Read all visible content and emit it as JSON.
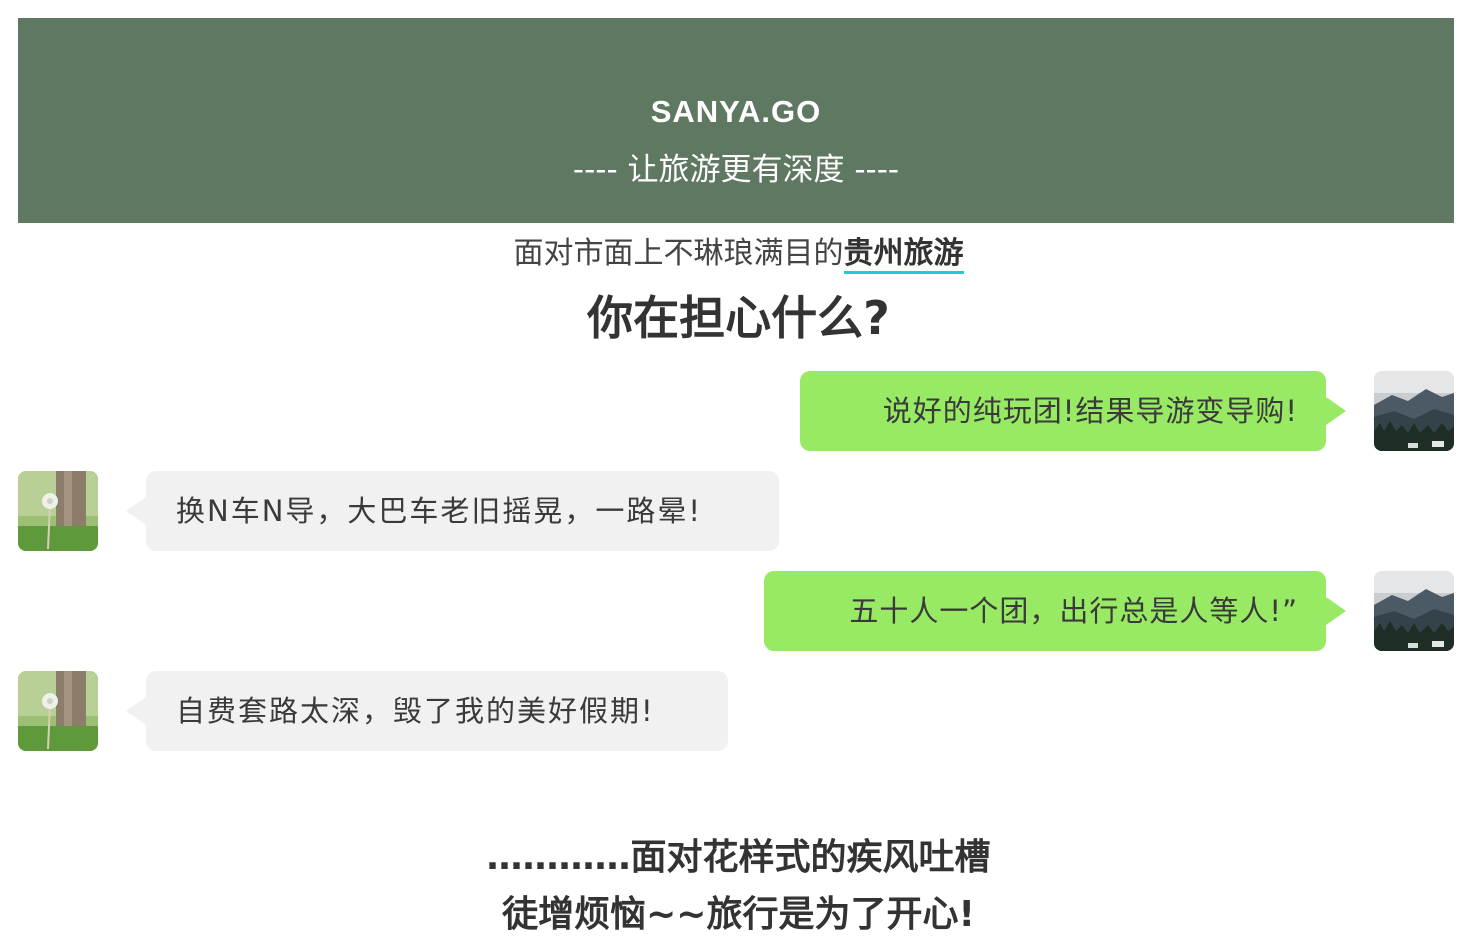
{
  "header": {
    "brand": "SANYA.GO",
    "tagline": "---- 让旅游更有深度 ----"
  },
  "intro": {
    "text": "面对市面上不琳琅满目的",
    "keyword": "贵州旅游",
    "question": "你在担心什么?"
  },
  "chat": {
    "messages": [
      {
        "side": "right",
        "avatar": "mountain-forest-avatar",
        "text": "说好的纯玩团!结果导游变导购!"
      },
      {
        "side": "left",
        "avatar": "dandelion-tree-avatar",
        "text": "换N车N导，大巴车老旧摇晃，一路晕!"
      },
      {
        "side": "right",
        "avatar": "mountain-forest-avatar",
        "text": "五十人一个团，出行总是人等人!”"
      },
      {
        "side": "left",
        "avatar": "dandelion-tree-avatar",
        "text": "自费套路太深，毁了我的美好假期!"
      }
    ]
  },
  "closing": {
    "line1": "…………面对花样式的疾风吐槽",
    "line2": "徒增烦恼~~旅行是为了开心!"
  },
  "colors": {
    "banner": "#5f7861",
    "bubble_right": "#98ea64",
    "bubble_left": "#f0f1f0",
    "keyword_underline": "#24c8e0"
  }
}
